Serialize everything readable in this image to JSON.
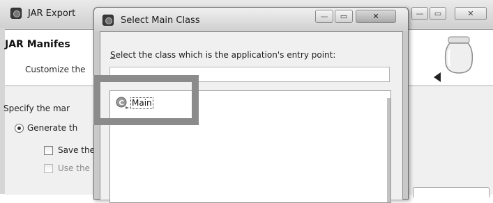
{
  "jar_export": {
    "title": "JAR Export",
    "header_title": "JAR Manifes",
    "header_subtitle": "Customize the",
    "specify_label": "Specify the mar",
    "generate_label": "Generate th",
    "save_label": "Save the",
    "use_label": "Use the",
    "header_icon": "jar-icon",
    "caption_minimize": "—",
    "caption_maximize": "▭",
    "caption_close": "✕"
  },
  "dialog": {
    "title": "Select Main Class",
    "prompt_label": "Select the class which is the application's entry point:",
    "prompt_mnemonic": "S",
    "prompt_rest": "elect the class which is the application's entry point:",
    "filter_value": "",
    "classes": [
      {
        "name": "Main",
        "icon": "class-icon"
      }
    ],
    "caption_minimize": "—",
    "caption_maximize": "▭",
    "caption_close": "✕"
  },
  "colors": {
    "highlight_border": "#8b8b8b",
    "selection_outline": "#333333"
  }
}
